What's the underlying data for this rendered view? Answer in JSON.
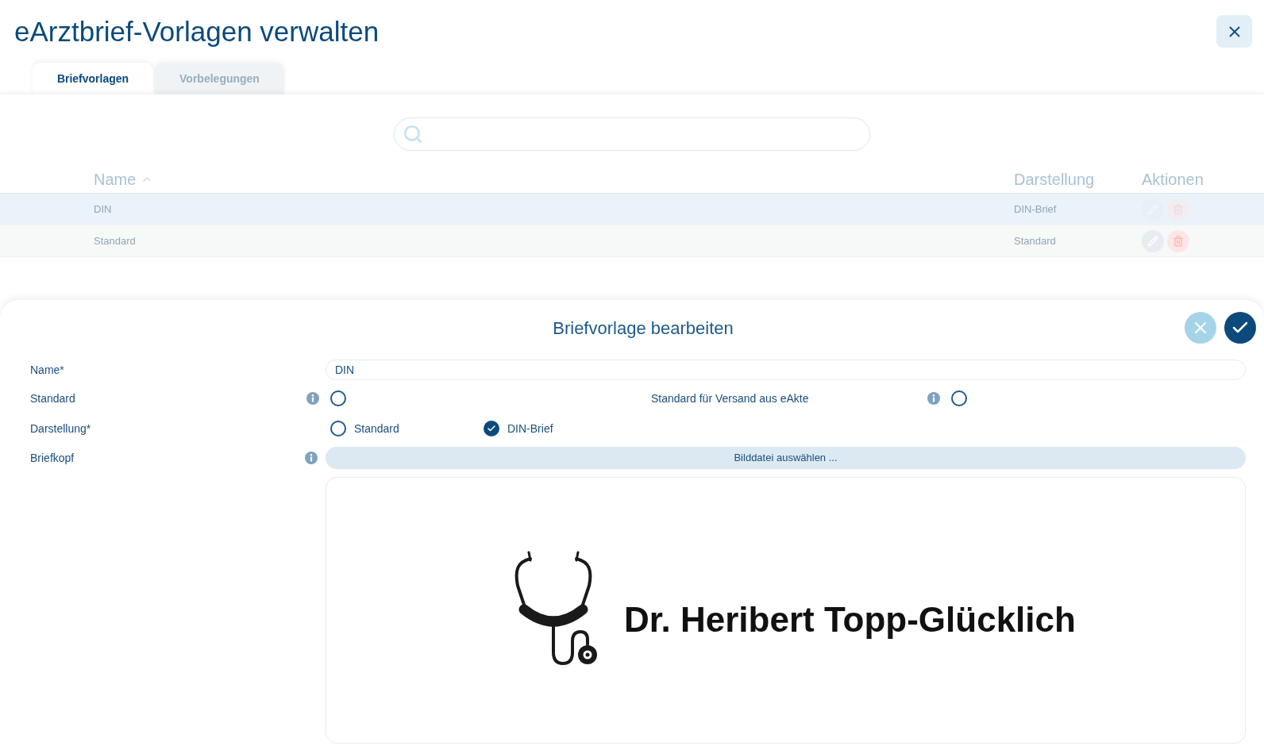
{
  "window": {
    "title": "eArztbrief-Vorlagen verwalten"
  },
  "tabs": [
    {
      "label": "Briefvorlagen",
      "selected": true
    },
    {
      "label": "Vorbelegungen",
      "selected": false
    }
  ],
  "table": {
    "columns": [
      {
        "label": "Name",
        "sorted": true
      },
      {
        "label": "Darstellung",
        "sorted": false
      },
      {
        "label": "Aktionen",
        "sorted": false
      }
    ],
    "rows": [
      {
        "name": "DIN",
        "darstellung": "DIN-Brief",
        "selected": true
      },
      {
        "name": "Standard",
        "darstellung": "Standard",
        "selected": false
      }
    ]
  },
  "editor": {
    "title": "Briefvorlage bearbeiten",
    "fields": [
      {
        "kind": "text",
        "label": "Name*",
        "value": "DIN"
      },
      {
        "kind": "pair",
        "items": [
          {
            "label": "Standard",
            "info": true,
            "checked": false
          },
          {
            "label": "Standard für Versand aus eAkte",
            "info": true,
            "checked": false
          }
        ]
      },
      {
        "kind": "radio",
        "label": "Darstellung*",
        "options": [
          {
            "label": "Standard",
            "selected": false
          },
          {
            "label": "DIN-Brief",
            "selected": true
          }
        ]
      },
      {
        "kind": "file",
        "label": "Briefkopf",
        "info": true,
        "button": "Bilddatei auswählen ...",
        "preview_text": "Dr. Heribert Topp-Glücklich"
      }
    ]
  }
}
